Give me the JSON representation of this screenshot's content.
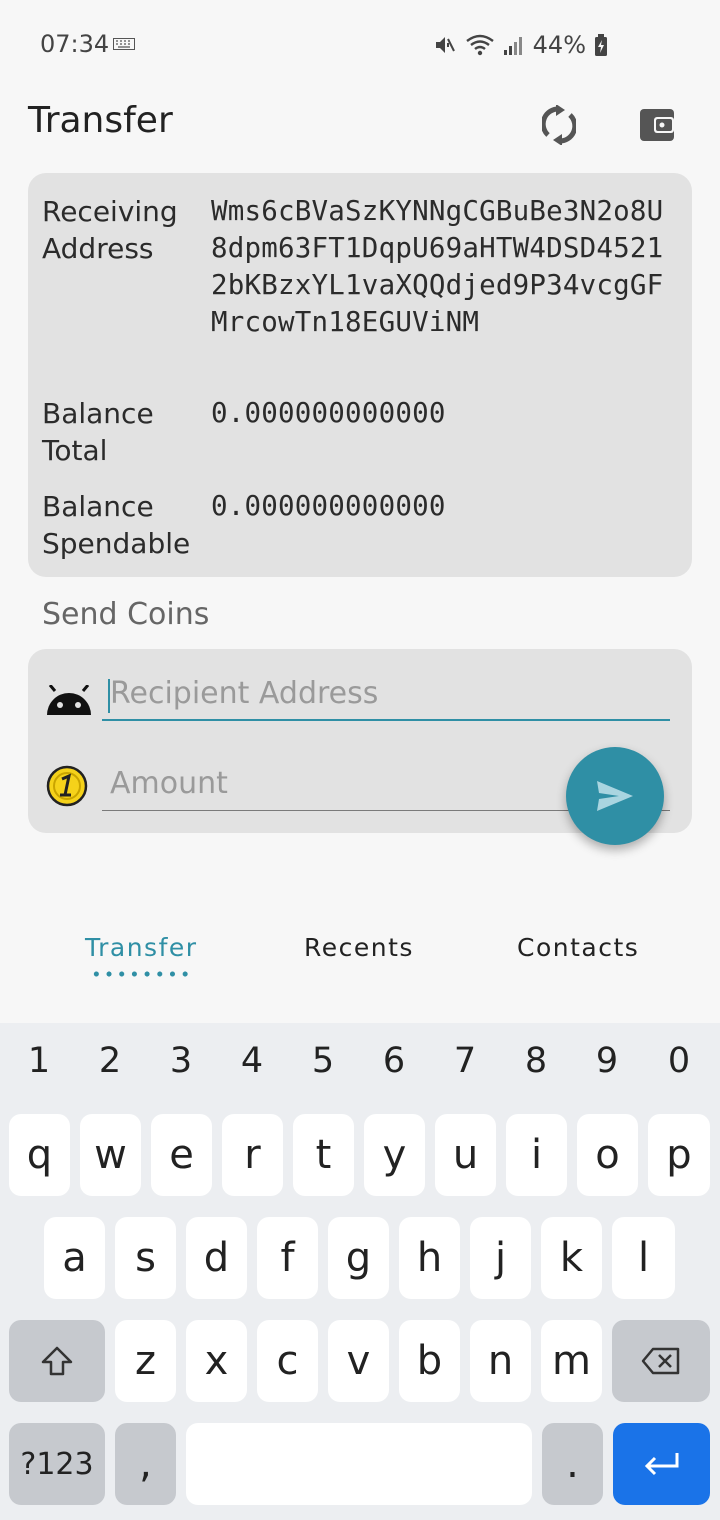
{
  "status_bar": {
    "time": "07:34",
    "battery_percent": "44%",
    "icons": [
      "keyboard-icon",
      "mute-icon",
      "wifi-icon",
      "signal-icon",
      "battery-charging-icon"
    ]
  },
  "app_bar": {
    "title": "Transfer",
    "actions": [
      "sync-icon",
      "wallet-icon"
    ]
  },
  "wallet": {
    "receiving_label": "Receiving Address",
    "receiving_address": "Wms6cBVaSzKYNNgCGBuBe3N2o8U8dpm63FT1DqpU69aHTW4DSD45212bKBzxYL1vaXQQdjed9P34vcgGFMrcowTn18EGUViNM",
    "balance_total_label": "Balance Total",
    "balance_total": "0.000000000000",
    "balance_spendable_label": "Balance Spendable",
    "balance_spendable": "0.000000000000"
  },
  "send": {
    "section_title": "Send Coins",
    "recipient_placeholder": "Recipient Address",
    "amount_placeholder": "Amount"
  },
  "tabs": [
    {
      "label": "Transfer",
      "active": true
    },
    {
      "label": "Recents",
      "active": false
    },
    {
      "label": "Contacts",
      "active": false
    }
  ],
  "keyboard": {
    "numbers": [
      "1",
      "2",
      "3",
      "4",
      "5",
      "6",
      "7",
      "8",
      "9",
      "0"
    ],
    "row1": [
      "q",
      "w",
      "e",
      "r",
      "t",
      "y",
      "u",
      "i",
      "o",
      "p"
    ],
    "row2": [
      "a",
      "s",
      "d",
      "f",
      "g",
      "h",
      "j",
      "k",
      "l"
    ],
    "row3": [
      "z",
      "x",
      "c",
      "v",
      "b",
      "n",
      "m"
    ],
    "symbols_label": "?123",
    "comma": ",",
    "period": "."
  },
  "colors": {
    "accent": "#2f8fa5",
    "card": "#e2e2e2",
    "enter_key": "#1a73e8"
  }
}
